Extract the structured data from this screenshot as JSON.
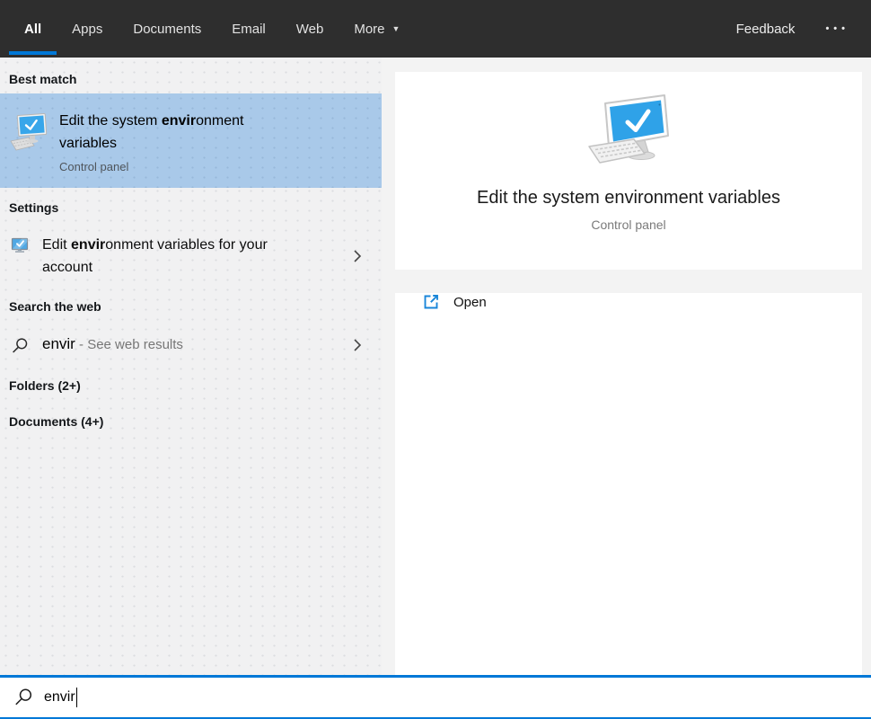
{
  "tabs_bar": {
    "tabs": [
      {
        "label": "All",
        "active": true
      },
      {
        "label": "Apps",
        "active": false
      },
      {
        "label": "Documents",
        "active": false
      },
      {
        "label": "Email",
        "active": false
      },
      {
        "label": "Web",
        "active": false
      },
      {
        "label": "More",
        "active": false,
        "has_dropdown": true
      }
    ],
    "feedback_label": "Feedback"
  },
  "icons": {
    "dropdown": "▼",
    "ellipsis": "•••"
  },
  "left_panel": {
    "best_match": {
      "header": "Best match",
      "item": {
        "title_pre": "Edit the system ",
        "title_match": "envir",
        "title_post": "onment variables",
        "subtitle": "Control panel",
        "icon": "monitor-check-icon"
      }
    },
    "settings": {
      "header": "Settings",
      "item": {
        "title_pre": "Edit ",
        "title_match": "envir",
        "title_post": "onment variables for your account",
        "icon": "display-check-icon"
      }
    },
    "web": {
      "header": "Search the web",
      "item": {
        "query": "envir",
        "suffix": " - See web results",
        "icon": "search-icon"
      }
    },
    "folders_header": "Folders (2+)",
    "documents_header": "Documents (4+)"
  },
  "preview_panel": {
    "icon": "monitor-check-icon",
    "title": "Edit the system environment variables",
    "subtitle": "Control panel",
    "open_action": {
      "label": "Open",
      "icon": "open-external-icon"
    }
  },
  "search_box": {
    "value": "envir",
    "icon": "search-icon"
  },
  "colors": {
    "accent": "#0078d7",
    "topbar_bg": "#2e2e2e",
    "highlight": "#a9c9e9",
    "panel_bg": "#f1f1f2",
    "screen_blue": "#2fa2e8"
  }
}
